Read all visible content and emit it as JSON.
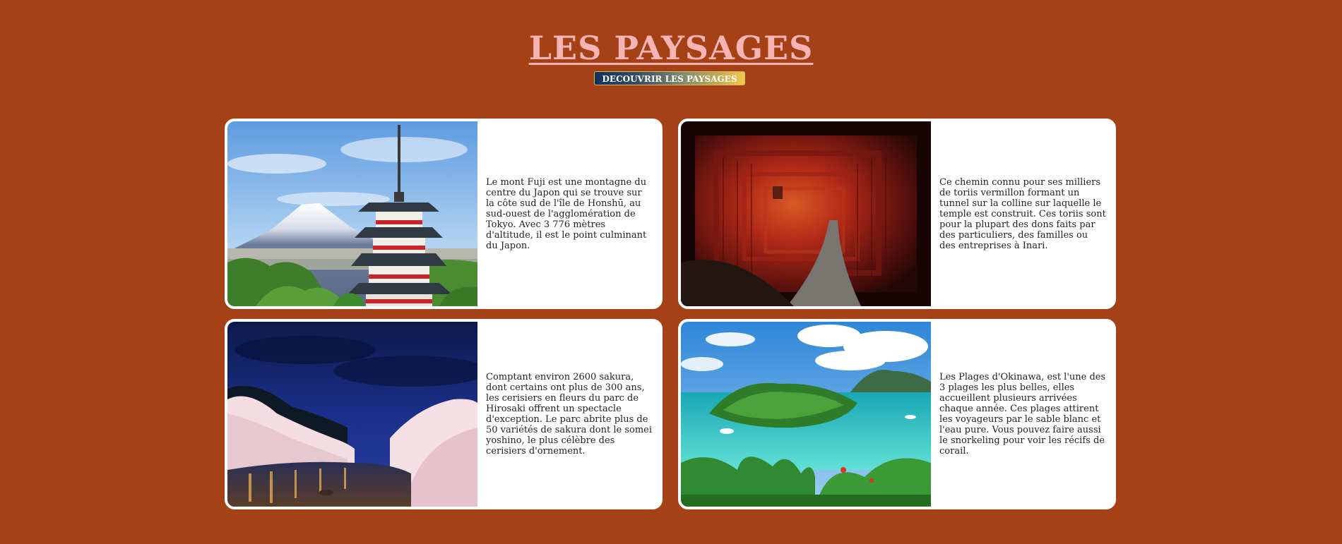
{
  "header": {
    "title": "LES PAYSAGES",
    "button_label": "DECOUVRIR LES PAYSAGES"
  },
  "colors": {
    "background": "#a54117",
    "title": "#f6b4b4",
    "card": "#ffffff"
  },
  "cards": [
    {
      "image": "mount-fuji-pagoda-photo",
      "text": "Le mont Fuji est une montagne du centre du Japon qui se trouve sur la côte sud de l'île de Honshū, au sud-ouest de l'agglomération de Tokyo. Avec 3 776 mètres d'altitude, il est le point culminant du Japon."
    },
    {
      "image": "torii-tunnel-photo",
      "text": "Ce chemin connu pour ses milliers de toriis vermillon formant un tunnel sur la colline sur laquelle le temple est construit. Ces toriis sont pour la plupart des dons faits par des particuliers, des familles ou des entreprises à Inari."
    },
    {
      "image": "hirosaki-cherry-blossom-photo",
      "text": "Comptant environ 2600 sakura, dont certains ont plus de 300 ans, les cerisiers en fleurs du parc de Hirosaki offrent un spectacle d'exception. Le parc abrite plus de 50 variétés de sakura dont le somei yoshino, le plus célèbre des cerisiers d'ornement."
    },
    {
      "image": "okinawa-beach-photo",
      "text": "Les Plages d'Okinawa, est l'une des 3 plages les plus belles, elles accueillent plusieurs arrivées chaque année. Ces plages attirent les voyageurs par le sable blanc et l'eau pure. Vous pouvez faire aussi le snorkeling pour voir les récifs de corail."
    }
  ]
}
